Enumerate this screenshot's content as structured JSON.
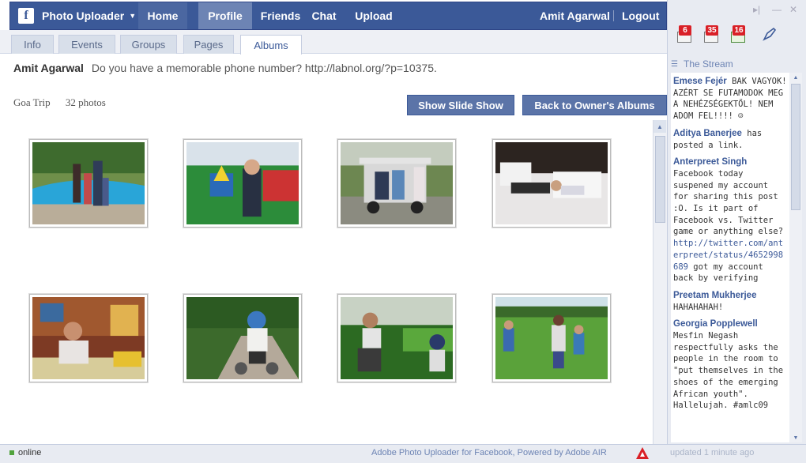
{
  "topbar": {
    "brand": "Photo Uploader",
    "nav": [
      "Home",
      "Profile",
      "Friends",
      "Chat",
      "Upload"
    ],
    "user": "Amit Agarwal",
    "logout": "Logout"
  },
  "tabs": [
    "Info",
    "Events",
    "Groups",
    "Pages",
    "Albums"
  ],
  "status": {
    "owner": "Amit Agarwal",
    "message": "Do you have a memorable phone number? http://labnol.org/?p=10375."
  },
  "album": {
    "name": "Goa Trip",
    "count": "32 photos",
    "slideshow_label": "Show Slide Show",
    "back_label": "Back to Owner's Albums"
  },
  "photos": [
    {
      "title": "pool-family"
    },
    {
      "title": "playground"
    },
    {
      "title": "golf-cart"
    },
    {
      "title": "sleeping-kids"
    },
    {
      "title": "kid-at-table"
    },
    {
      "title": "kid-tricycle"
    },
    {
      "title": "man-and-child-garden"
    },
    {
      "title": "kids-on-lawn"
    }
  ],
  "notifications": {
    "badges": [
      "6",
      "35",
      "16"
    ]
  },
  "stream": {
    "title": "The Stream",
    "posts": [
      {
        "author": "Emese Fejér",
        "text": "BAK VAGYOK! AZÉRT SE FUTAMODOK MEG A NEHÉZSÉGEKTŐL! NEM ADOM FEL!!!! ☺"
      },
      {
        "author": "Aditya Banerjee",
        "text": "has posted a link."
      },
      {
        "author": "Anterpreet Singh",
        "text": "Facebook today suspened my account for sharing this post :O. Is it part of Facebook vs. Twitter game or anything else?",
        "link": "http://twitter.com/anterpreet/status/4652998689",
        "text2": "got my account back by verifying"
      },
      {
        "author": "Preetam Mukherjee",
        "text": "HAHAHAHAH!"
      },
      {
        "author": "Georgia Popplewell",
        "text": "Mesfin Negash respectfully asks the people in the room to \"put themselves in the shoes of the emerging African youth\". Hallelujah. #amlc09"
      }
    ]
  },
  "footer": {
    "online": "online",
    "powered": "Adobe Photo Uploader for Facebook, Powered by Adobe AIR",
    "updated": "updated 1 minute ago"
  },
  "colors": {
    "brand": "#3b5998",
    "badge": "#d92027"
  }
}
